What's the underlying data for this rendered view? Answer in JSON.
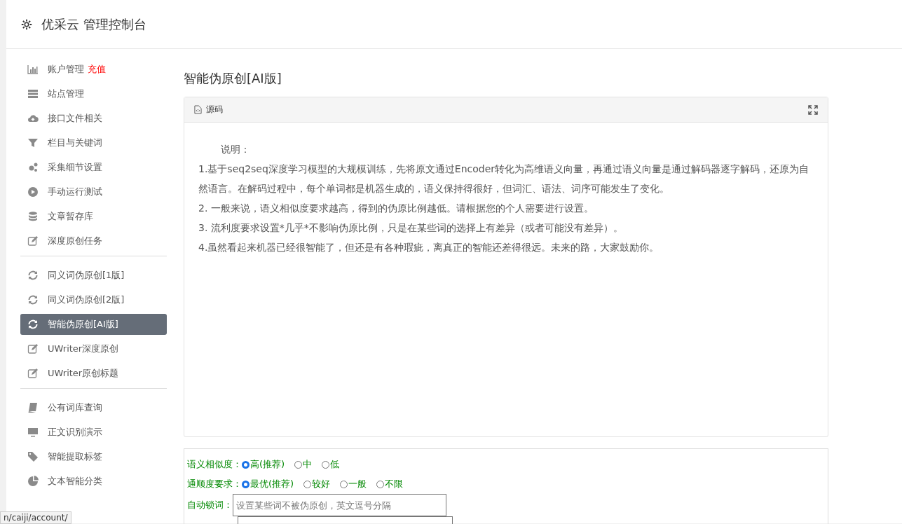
{
  "header": {
    "title": "优采云 管理控制台"
  },
  "sidebar": {
    "groups": [
      [
        {
          "label": "账户管理",
          "badge": "充值",
          "selected": false
        },
        {
          "label": "站点管理",
          "selected": false
        },
        {
          "label": "接口文件相关",
          "selected": false
        },
        {
          "label": "栏目与关键词",
          "selected": false
        },
        {
          "label": "采集细节设置",
          "selected": false
        },
        {
          "label": "手动运行测试",
          "selected": false
        },
        {
          "label": "文章暂存库",
          "selected": false
        },
        {
          "label": "深度原创任务",
          "selected": false
        }
      ],
      [
        {
          "label": "同义词伪原创[1版]",
          "selected": false
        },
        {
          "label": "同义词伪原创[2版]",
          "selected": false
        },
        {
          "label": "智能伪原创[AI版]",
          "selected": true
        },
        {
          "label": "UWriter深度原创",
          "selected": false
        },
        {
          "label": "UWriter原创标题",
          "selected": false
        }
      ],
      [
        {
          "label": "公有词库查询",
          "selected": false
        },
        {
          "label": "正文识别演示",
          "selected": false
        },
        {
          "label": "智能提取标签",
          "selected": false
        },
        {
          "label": "文本智能分类",
          "selected": false
        }
      ]
    ]
  },
  "page_title": "智能伪原创[AI版]",
  "source_panel": {
    "tab": "源码",
    "heading": "说明：",
    "paragraphs": [
      "1.基于seq2seq深度学习模型的大规模训练，先将原文通过Encoder转化为高维语义向量，再通过语义向量是通过解码器逐字解码，还原为自然语言。在解码过程中，每个单词都是机器生成的，语义保持得很好，但词汇、语法、词序可能发生了变化。",
      "2. 一般来说，语义相似度要求越高，得到的伪原比例越低。请根据您的个人需要进行设置。",
      "3. 流利度要求设置*几乎*不影响伪原比例，只是在某些词的选择上有差异（或者可能没有差异）。",
      "4.虽然看起来机器已经很智能了，但还是有各种瑕疵，离真正的智能还差得很远。未来的路，大家鼓励你。"
    ]
  },
  "form": {
    "radio_groups": [
      {
        "label": "语义相似度：",
        "options": [
          {
            "label": "高(推荐)",
            "selected": true
          },
          {
            "label": "中",
            "selected": false
          },
          {
            "label": "低",
            "selected": false
          }
        ]
      },
      {
        "label": "通顺度要求：",
        "options": [
          {
            "label": "最优(推荐)",
            "selected": true
          },
          {
            "label": "较好",
            "selected": false
          },
          {
            "label": "一般",
            "selected": false
          },
          {
            "label": "不限",
            "selected": false
          }
        ]
      }
    ],
    "lock_words": {
      "label": "自动锁词：",
      "placeholder": "设置某些词不被伪原创，英文逗号分隔"
    }
  },
  "status_url": "n/caiji/account/"
}
